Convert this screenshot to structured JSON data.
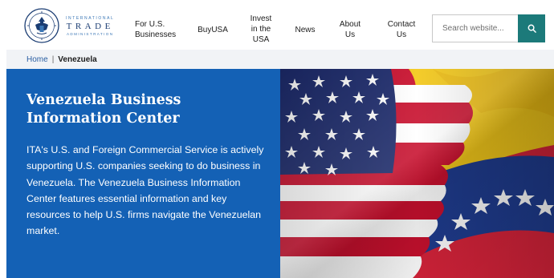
{
  "brand": {
    "logo_line1": "INTERNATIONAL",
    "logo_line2": "TRADE",
    "logo_line3": "ADMINISTRATION"
  },
  "nav": {
    "items": [
      {
        "label": "For U.S. Businesses"
      },
      {
        "label": "BuyUSA"
      },
      {
        "label": "Invest in the USA"
      },
      {
        "label": "News"
      },
      {
        "label": "About Us"
      },
      {
        "label": "Contact Us"
      }
    ]
  },
  "search": {
    "placeholder": "Search website...",
    "button_icon": "search-icon"
  },
  "breadcrumb": {
    "home": "Home",
    "separator": "|",
    "current": "Venezuela"
  },
  "hero": {
    "title": "Venezuela Business Information Center",
    "description": "ITA's U.S. and Foreign Commercial Service is actively supporting U.S. companies seeking to do business in Venezuela. The Venezuela Business Information Center features essential information and key resources to help U.S. firms navigate the Venezuelan market.",
    "image": "us-and-venezuela-flags"
  },
  "colors": {
    "hero_blue": "#1461b5",
    "search_button": "#1c7a7a",
    "link_blue": "#2b5fa3",
    "breadcrumb_bg": "#f1f3f6"
  }
}
